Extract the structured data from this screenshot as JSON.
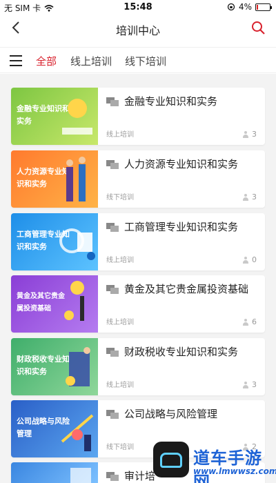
{
  "status_bar": {
    "carrier": "无 SIM 卡",
    "time": "15:48",
    "battery": "4%"
  },
  "nav": {
    "title": "培训中心"
  },
  "tabs": [
    {
      "label": "全部",
      "active": true
    },
    {
      "label": "线上培训",
      "active": false
    },
    {
      "label": "线下培训",
      "active": false
    }
  ],
  "colors": {
    "accent": "#d8202c"
  },
  "courses": [
    {
      "thumb_text": "金融专业知识和实务",
      "title": "金融专业知识和实务",
      "type": "线上培训",
      "count": "3",
      "thumb_colors": [
        "#7dc642",
        "#c8e86a"
      ]
    },
    {
      "thumb_text": "人力资源专业知识和实务",
      "title": "人力资源专业知识和实务",
      "type": "线下培训",
      "count": "3",
      "thumb_colors": [
        "#ff7a2e",
        "#ffb347"
      ]
    },
    {
      "thumb_text": "工商管理专业知识和实务",
      "title": "工商管理专业知识和实务",
      "type": "线上培训",
      "count": "0",
      "thumb_colors": [
        "#1e8ee8",
        "#5dc3ff"
      ]
    },
    {
      "thumb_text": "黄金及其它贵金属投资基础",
      "title": "黄金及其它贵金属投资基础",
      "type": "线上培训",
      "count": "6",
      "thumb_colors": [
        "#8a3ed6",
        "#b57cf0"
      ]
    },
    {
      "thumb_text": "财政税收专业知识和实务",
      "title": "财政税收专业知识和实务",
      "type": "线上培训",
      "count": "3",
      "thumb_colors": [
        "#3fae6b",
        "#8fd79a"
      ]
    },
    {
      "thumb_text": "公司战略与风险管理",
      "title": "公司战略与风险管理",
      "type": "线下培训",
      "count": "2",
      "thumb_colors": [
        "#2a5fc7",
        "#5ba6f0"
      ]
    },
    {
      "thumb_text": "",
      "title": "审计培",
      "type": "",
      "count": "",
      "thumb_colors": [
        "#3a86e0",
        "#7cc0ff"
      ]
    }
  ],
  "watermark": {
    "name": "道车手游网",
    "url": "www.lmwwsz.com"
  }
}
